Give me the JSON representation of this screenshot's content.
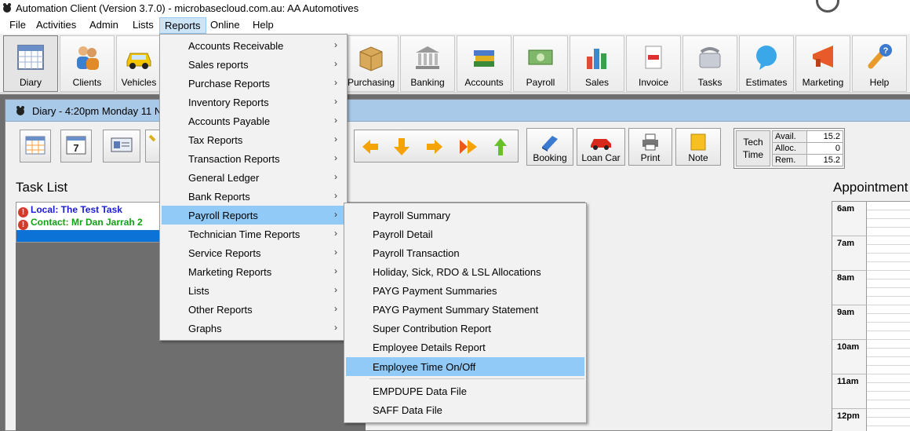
{
  "window": {
    "title": "Automation Client (Version 3.7.0) - microbasecloud.com.au: AA Automotives"
  },
  "menubar": {
    "items": [
      "File",
      "Activities",
      "Admin",
      "Lists",
      "Reports",
      "Online",
      "Help"
    ],
    "active": "Reports"
  },
  "toolbar": {
    "buttons": [
      {
        "label": "Diary",
        "icon": "calendar-icon"
      },
      {
        "label": "Clients",
        "icon": "people-icon"
      },
      {
        "label": "Vehicles",
        "icon": "car-icon"
      },
      {
        "label": "Purchasing",
        "icon": "box-icon"
      },
      {
        "label": "Banking",
        "icon": "bank-icon"
      },
      {
        "label": "Accounts",
        "icon": "ledger-books-icon"
      },
      {
        "label": "Payroll",
        "icon": "money-icon"
      },
      {
        "label": "Sales",
        "icon": "bar-chart-icon"
      },
      {
        "label": "Invoice",
        "icon": "invoice-icon"
      },
      {
        "label": "Tasks",
        "icon": "phone-icon"
      },
      {
        "label": "Estimates",
        "icon": "speech-bubble-icon"
      },
      {
        "label": "Marketing",
        "icon": "megaphone-icon"
      },
      {
        "label": "Help",
        "icon": "help-icon"
      }
    ]
  },
  "diary": {
    "title": "Diary - 4:20pm Monday 11 N",
    "buttons": [
      {
        "label": "Booking",
        "icon": "book-icon"
      },
      {
        "label": "Loan Car",
        "icon": "red-car-icon"
      },
      {
        "label": "Print",
        "icon": "printer-icon"
      },
      {
        "label": "Note",
        "icon": "note-icon"
      }
    ],
    "tech_time": {
      "header": "Tech Time",
      "rows": [
        {
          "key": "Avail.",
          "value": "15.2"
        },
        {
          "key": "Alloc.",
          "value": "0"
        },
        {
          "key": "Rem.",
          "value": "15.2"
        }
      ]
    },
    "task_list": {
      "title": "Task List",
      "tasks": [
        {
          "text": "Local: The Test Task",
          "color": "#1a1ad6"
        },
        {
          "text": "Contact: Mr Dan Jarrah 2",
          "color": "#14a014"
        }
      ]
    },
    "appointments": {
      "title": "Appointment",
      "slots": [
        "6am",
        "7am",
        "8am",
        "9am",
        "10am",
        "11am",
        "12pm"
      ]
    }
  },
  "reports_menu": {
    "items": [
      "Accounts Receivable",
      "Sales reports",
      "Purchase Reports",
      "Inventory Reports",
      "Accounts Payable",
      "Tax Reports",
      "Transaction Reports",
      "General Ledger",
      "Bank Reports",
      "Payroll Reports",
      "Technician Time Reports",
      "Service Reports",
      "Marketing Reports",
      "Lists",
      "Other Reports",
      "Graphs"
    ],
    "active": "Payroll Reports"
  },
  "payroll_menu": {
    "items": [
      "Payroll Summary",
      "Payroll Detail",
      "Payroll Transaction",
      "Holiday, Sick, RDO & LSL Allocations",
      "PAYG Payment Summaries",
      "PAYG Payment Summary Statement",
      "Super Contribution Report",
      "Employee Details Report",
      "Employee Time On/Off"
    ],
    "extra_items": [
      "EMPDUPE Data File",
      "SAFF Data File"
    ],
    "active": "Employee Time On/Off"
  }
}
